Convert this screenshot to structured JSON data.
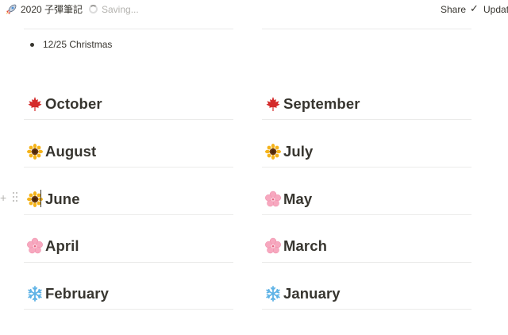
{
  "topbar": {
    "page_icon": "rocket-icon",
    "page_title": "2020 子彈筆記",
    "status": "Saving...",
    "share_label": "Share",
    "update_label": "Updat"
  },
  "bullet_list": [
    {
      "text": "12/25 Christmas"
    }
  ],
  "months": {
    "left": [
      {
        "label": "October",
        "icon": "maple-leaf-icon"
      },
      {
        "label": "August",
        "icon": "sunflower-icon"
      },
      {
        "label": "June",
        "icon": "sunflower-icon"
      },
      {
        "label": "April",
        "icon": "cherry-blossom-icon"
      },
      {
        "label": "February",
        "icon": "snowflake-icon"
      }
    ],
    "right": [
      {
        "label": "September",
        "icon": "maple-leaf-icon"
      },
      {
        "label": "July",
        "icon": "sunflower-icon"
      },
      {
        "label": "May",
        "icon": "cherry-blossom-icon"
      },
      {
        "label": "March",
        "icon": "cherry-blossom-icon"
      },
      {
        "label": "January",
        "icon": "snowflake-icon"
      }
    ]
  },
  "colors": {
    "text": "#37352f",
    "divider": "#ebebea",
    "muted": "#b3b2ae",
    "maple": "#d42a2a",
    "sunflower_petal": "#f5b31a",
    "sunflower_center": "#6b3a12",
    "blossom": "#f7a8bf",
    "snowflake": "#5fb3e6"
  }
}
